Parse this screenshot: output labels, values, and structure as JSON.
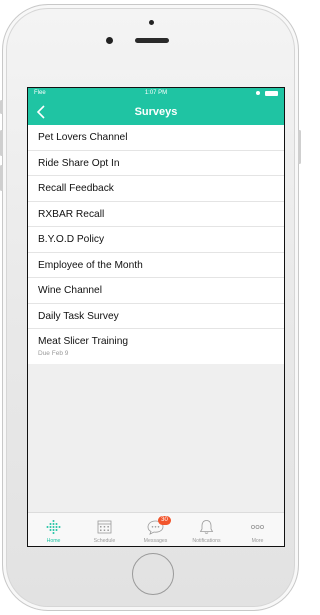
{
  "status_bar": {
    "carrier": "Flee",
    "time": "1:07 PM"
  },
  "navbar": {
    "back_icon": "chevron-left-icon",
    "title": "Surveys"
  },
  "surveys": [
    {
      "label": "Pet Lovers Channel"
    },
    {
      "label": "Ride Share Opt In"
    },
    {
      "label": "Recall Feedback"
    },
    {
      "label": "RXBAR Recall"
    },
    {
      "label": "B.Y.O.D Policy"
    },
    {
      "label": "Employee of the Month"
    },
    {
      "label": "Wine Channel"
    },
    {
      "label": "Daily Task Survey"
    },
    {
      "label": "Meat Slicer Training",
      "due": "Due Feb 9"
    }
  ],
  "tabbar": {
    "tabs": [
      {
        "label": "Home",
        "icon": "home-dots-icon"
      },
      {
        "label": "Schedule",
        "icon": "calendar-icon"
      },
      {
        "label": "Messages",
        "icon": "chat-bubble-icon",
        "badge": "30"
      },
      {
        "label": "Notifications",
        "icon": "bell-icon"
      },
      {
        "label": "More",
        "icon": "more-dots-icon"
      }
    ],
    "active": "Home"
  },
  "colors": {
    "accent": "#1fc4a3",
    "badge": "#f2552c"
  }
}
